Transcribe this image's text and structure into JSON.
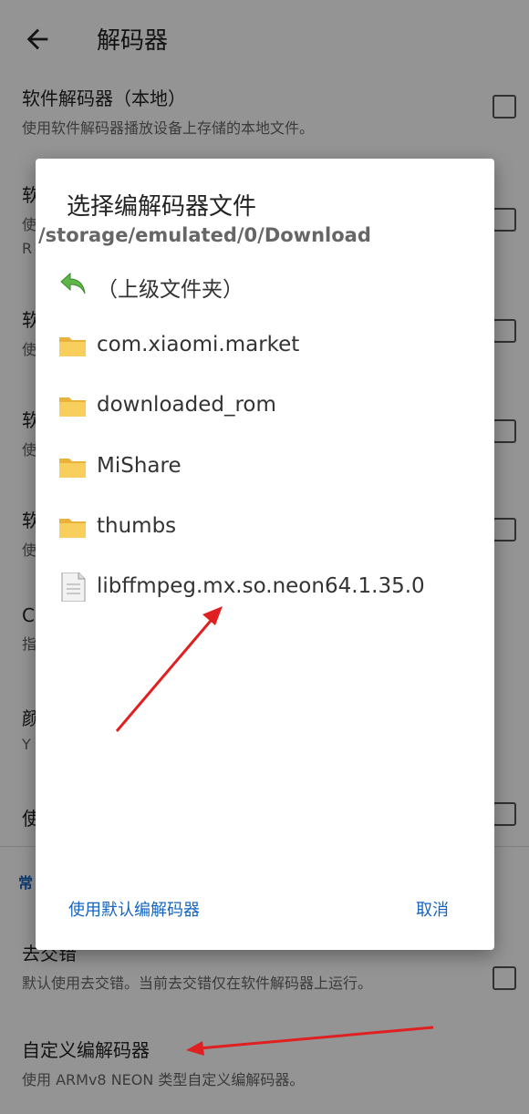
{
  "appbar": {
    "title": "解码器",
    "back_icon": "arrow-back-icon"
  },
  "settings": [
    {
      "title": "软件解码器（本地）",
      "subtitle": "使用软件解码器播放设备上存储的本地文件。",
      "checkbox": true
    },
    {
      "title": "软",
      "subtitle": "使",
      "line3": "R",
      "checkbox": true
    },
    {
      "title": "软",
      "subtitle": "使",
      "checkbox": true
    },
    {
      "title": "软",
      "subtitle": "使",
      "checkbox": true
    },
    {
      "title": "软",
      "subtitle": "使",
      "checkbox": true
    },
    {
      "title": "C",
      "subtitle": "指"
    },
    {
      "title": "颜",
      "subtitle": "Y"
    },
    {
      "title": "使",
      "checkbox": true
    }
  ],
  "section_header": "常",
  "deinterlace": {
    "title": "去交错",
    "subtitle": "默认使用去交错。当前去交错仅在软件解码器上运行。",
    "checkbox": true
  },
  "custom_codec": {
    "title": "自定义编解码器",
    "subtitle": "使用 ARMv8 NEON 类型自定义编解码器。"
  },
  "dialog": {
    "title": "选择编解码器文件",
    "path": "/storage/emulated/0/Download",
    "items": [
      {
        "label": "（上级文件夹）",
        "icon": "parent-folder-icon"
      },
      {
        "label": "com.xiaomi.market",
        "icon": "folder-icon"
      },
      {
        "label": "downloaded_rom",
        "icon": "folder-icon"
      },
      {
        "label": "MiShare",
        "icon": "folder-icon"
      },
      {
        "label": "thumbs",
        "icon": "folder-icon"
      },
      {
        "label": "libffmpeg.mx.so.neon64.1.35.0",
        "icon": "file-icon"
      }
    ],
    "default_button": "使用默认编解码器",
    "cancel_button": "取消"
  },
  "colors": {
    "accent": "#1565c0",
    "annotation": "#e02020",
    "folder": "#f6c548"
  }
}
